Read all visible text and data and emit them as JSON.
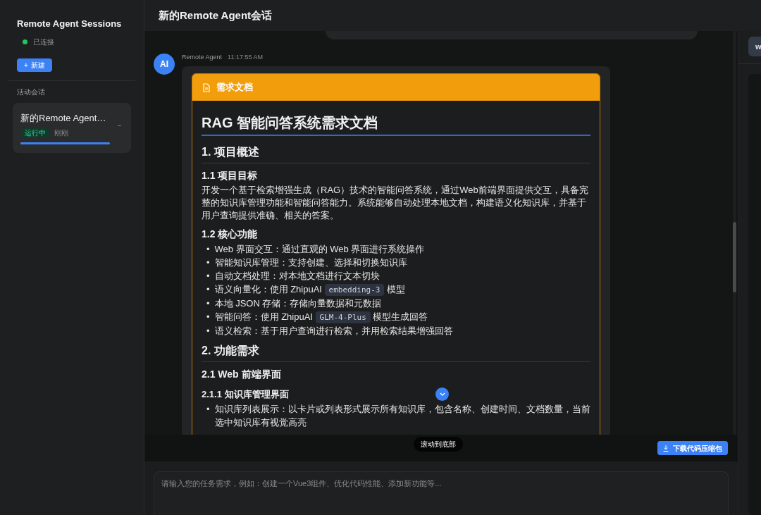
{
  "sidebar": {
    "title": "Remote Agent Sessions",
    "status": {
      "text": "已连接",
      "connected": true
    },
    "new_button": {
      "icon": "+",
      "label": "新建"
    },
    "section_label": "活动会话",
    "sessions": [
      {
        "title": "新的Remote Agent…",
        "badge": "运行中",
        "time": "刚刚",
        "level": 1,
        "selected": true
      }
    ]
  },
  "header": {
    "title": "新的Remote Agent会话"
  },
  "message": {
    "avatar": "AI",
    "sender": "Remote Agent",
    "time": "11:17:55 AM",
    "document": {
      "label": "需求文档",
      "blocks": [
        {
          "kind": "h1",
          "text": "RAG 智能问答系统需求文档"
        },
        {
          "kind": "h2",
          "text": "1. 项目概述"
        },
        {
          "kind": "h3",
          "text": "1.1 项目目标"
        },
        {
          "kind": "p",
          "text": "开发一个基于检索增强生成（RAG）技术的智能问答系统，通过Web前端界面提供交互，具备完整的知识库管理功能和智能问答能力。系统能够自动处理本地文档，构建语义化知识库，并基于用户查询提供准确、相关的答案。"
        },
        {
          "kind": "h3",
          "text": "1.2 核心功能"
        },
        {
          "kind": "ul",
          "items": [
            {
              "marker": "•",
              "parts": [
                {
                  "kind": "text",
                  "text": "Web 界面交互：通过直观的 Web 界面进行系统操作"
                }
              ]
            },
            {
              "marker": "•",
              "parts": [
                {
                  "kind": "text",
                  "text": "智能知识库管理：支持创建、选择和切换知识库"
                }
              ]
            },
            {
              "marker": "•",
              "parts": [
                {
                  "kind": "text",
                  "text": "自动文档处理：对本地文档进行文本切块"
                }
              ]
            },
            {
              "marker": "•",
              "parts": [
                {
                  "kind": "text",
                  "text": "语义向量化：使用 ZhipuAI "
                },
                {
                  "kind": "code",
                  "text": "embedding-3"
                },
                {
                  "kind": "text",
                  "text": " 模型"
                }
              ]
            },
            {
              "marker": "•",
              "parts": [
                {
                  "kind": "text",
                  "text": "本地 JSON 存储：存储向量数据和元数据"
                }
              ]
            },
            {
              "marker": "•",
              "parts": [
                {
                  "kind": "text",
                  "text": "智能问答：使用 ZhipuAI "
                },
                {
                  "kind": "code",
                  "text": "GLM-4-Plus"
                },
                {
                  "kind": "text",
                  "text": " 模型生成回答"
                }
              ]
            },
            {
              "marker": "•",
              "parts": [
                {
                  "kind": "text",
                  "text": "语义检索：基于用户查询进行检索，并用检索结果增强回答"
                }
              ]
            }
          ]
        },
        {
          "kind": "h2",
          "text": "2. 功能需求"
        },
        {
          "kind": "h3",
          "text": "2.1 Web 前端界面"
        },
        {
          "kind": "h4",
          "text": "2.1.1 知识库管理界面",
          "scroll_button": true
        },
        {
          "kind": "ul",
          "items": [
            {
              "marker": "•",
              "parts": [
                {
                  "kind": "text",
                  "text": "知识库列表展示：以卡片或列表形式展示所有知识库，包含名称、创建时间、文档数量，当前选中知识库有视觉高亮"
                }
              ]
            }
          ]
        }
      ]
    }
  },
  "scroll_tooltip": "滚动到底部",
  "download_button": "下载代码压缩包",
  "input": {
    "placeholder": "请输入您的任务需求，例如：创建一个Vue3组件、优化代码性能、添加新功能等..."
  },
  "right_panel": {
    "tab": "w"
  }
}
